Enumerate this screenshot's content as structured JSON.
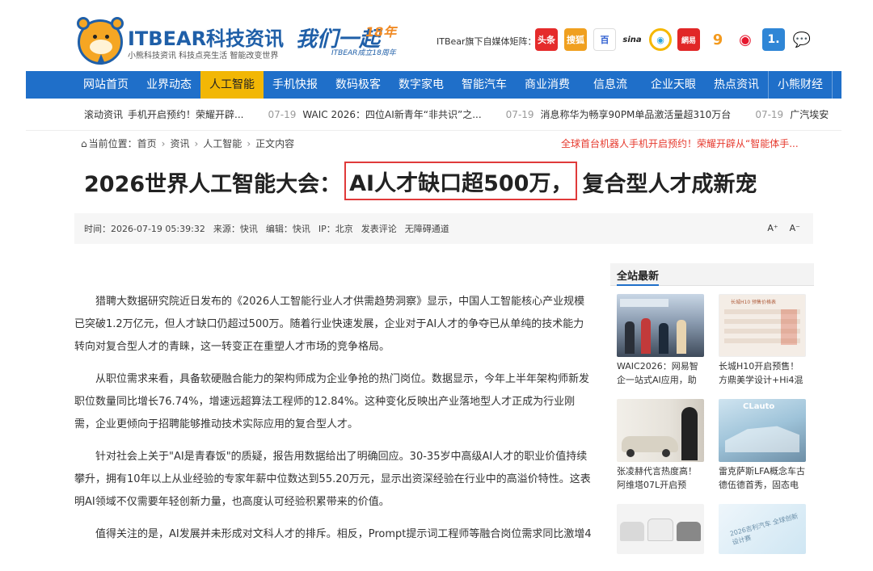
{
  "header": {
    "brand": "ITBEAR科技资讯",
    "slogan": "小熊科技资讯  科技点亮生活  智能改变世界",
    "anniversary_script": "我们一起",
    "anniversary_num": "18年",
    "anniversary_sub": "ITBEAR成立18周年",
    "media_matrix_label": "ITBear旗下自媒体矩阵：",
    "media_icons": [
      "头条",
      "搜狐",
      "百",
      "sina",
      "◉",
      "網易",
      "9",
      "◉",
      "1.",
      "💬"
    ]
  },
  "nav": {
    "items": [
      "网站首页",
      "业界动态",
      "人工智能",
      "手机快报",
      "数码极客",
      "数字家电",
      "智能汽车",
      "商业消费",
      "信息流",
      "企业天眼",
      "热点资讯",
      "小熊财经"
    ],
    "active_index": 2
  },
  "ticker": {
    "label": "滚动资讯",
    "items": [
      {
        "text": "手机开启预约！荣耀开辟...",
        "time": "07-19"
      },
      {
        "text": "WAIC 2026：四位AI新青年“非共识”之...",
        "time": "07-19"
      },
      {
        "text": "消息称华为畅享90PM单品激活量超310万台",
        "time": "07-19"
      },
      {
        "text": "广汽埃安",
        "time": ""
      }
    ]
  },
  "breadcrumb": {
    "label": "当前位置：",
    "items": [
      "首页",
      "资讯",
      "人工智能",
      "正文内容"
    ]
  },
  "promo": "全球首台机器人手机开启预约！荣耀开辟从“智能体手...",
  "article": {
    "title_pre": "2026世界人工智能大会：",
    "title_hl": "AI人才缺口超500万，",
    "title_post": "复合型人才成新宠",
    "meta": {
      "time": "时间：2026-07-19 05:39:32",
      "source": "来源：快讯",
      "editor": "编辑：快讯",
      "ip": "IP：北京",
      "comment": "发表评论",
      "accessible": "无障碍通道",
      "font_larger": "A⁺",
      "font_smaller": "A⁻"
    },
    "paragraphs": [
      "猎聘大数据研究院近日发布的《2026人工智能行业人才供需趋势洞察》显示，中国人工智能核心产业规模已突破1.2万亿元，但人才缺口仍超过500万。随着行业快速发展，企业对于AI人才的争夺已从单纯的技术能力转向对复合型人才的青睐，这一转变正在重塑人才市场的竞争格局。",
      "从职位需求来看，具备软硬融合能力的架构师成为企业争抢的热门岗位。数据显示，今年上半年架构师新发职位数量同比增长76.74%，增速远超算法工程师的12.84%。这种变化反映出产业落地型人才正成为行业刚需，企业更倾向于招聘能够推动技术实际应用的复合型人才。",
      "针对社会上关于\"AI是青春饭\"的质疑，报告用数据给出了明确回应。30-35岁中高级AI人才的职业价值持续攀升，拥有10年以上从业经验的专家年薪中位数达到55.20万元，显示出资深经验在行业中的高溢价特性。这表明AI领域不仅需要年轻创新力量，也高度认可经验积累带来的价值。",
      "值得关注的是，AI发展并未形成对文科人才的排斥。相反，Prompt提示词工程师等融合岗位需求同比激增4"
    ]
  },
  "sidebar": {
    "heading": "全站最新",
    "cards": [
      {
        "caption": "WAIC2026：网易智企一站式AI应用，助力企业..."
      },
      {
        "caption": "长城H10开启预售！方鼎美学设计+Hi4混动 预售..."
      },
      {
        "caption": "张凌赫代言热度高！阿维塔07L开启预售，智驾强..."
      },
      {
        "caption": "雷克萨斯LFA概念车古德伍德首秀，固态电池加专..."
      },
      {
        "caption": ""
      },
      {
        "caption": ""
      }
    ],
    "thumb_text": [
      "",
      "长城H10 预售价格表",
      "",
      "CLauto",
      "",
      "2026吉利汽车 全球创新设计赛"
    ]
  }
}
